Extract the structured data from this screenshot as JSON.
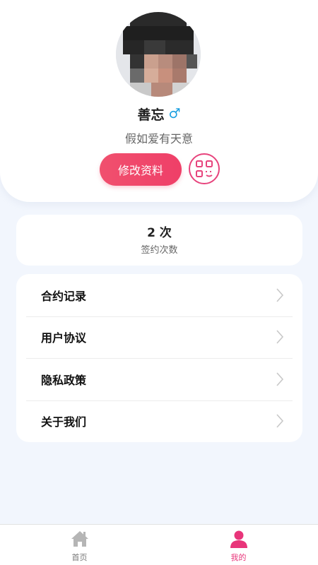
{
  "profile": {
    "name": "善忘",
    "gender_symbol": "♂",
    "signature": "假如爱有天意",
    "edit_button_label": "修改资料",
    "avatar_icon": "user-avatar-pixelated",
    "qr_icon": "qr-code-icon"
  },
  "stats": {
    "value": "2 次",
    "label": "签约次数"
  },
  "menu": {
    "items": [
      {
        "label": "合约记录",
        "icon": "chevron-right-icon"
      },
      {
        "label": "用户协议",
        "icon": "chevron-right-icon"
      },
      {
        "label": "隐私政策",
        "icon": "chevron-right-icon"
      },
      {
        "label": "关于我们",
        "icon": "chevron-right-icon"
      }
    ]
  },
  "tabbar": {
    "tabs": [
      {
        "label": "首页",
        "icon": "home-icon",
        "active": false
      },
      {
        "label": "我的",
        "icon": "person-icon",
        "active": true
      }
    ]
  },
  "colors": {
    "accent": "#ef3f68",
    "accent_pink": "#e8357a",
    "gender_blue": "#1a9fe0",
    "background": "#f2f6fd"
  }
}
